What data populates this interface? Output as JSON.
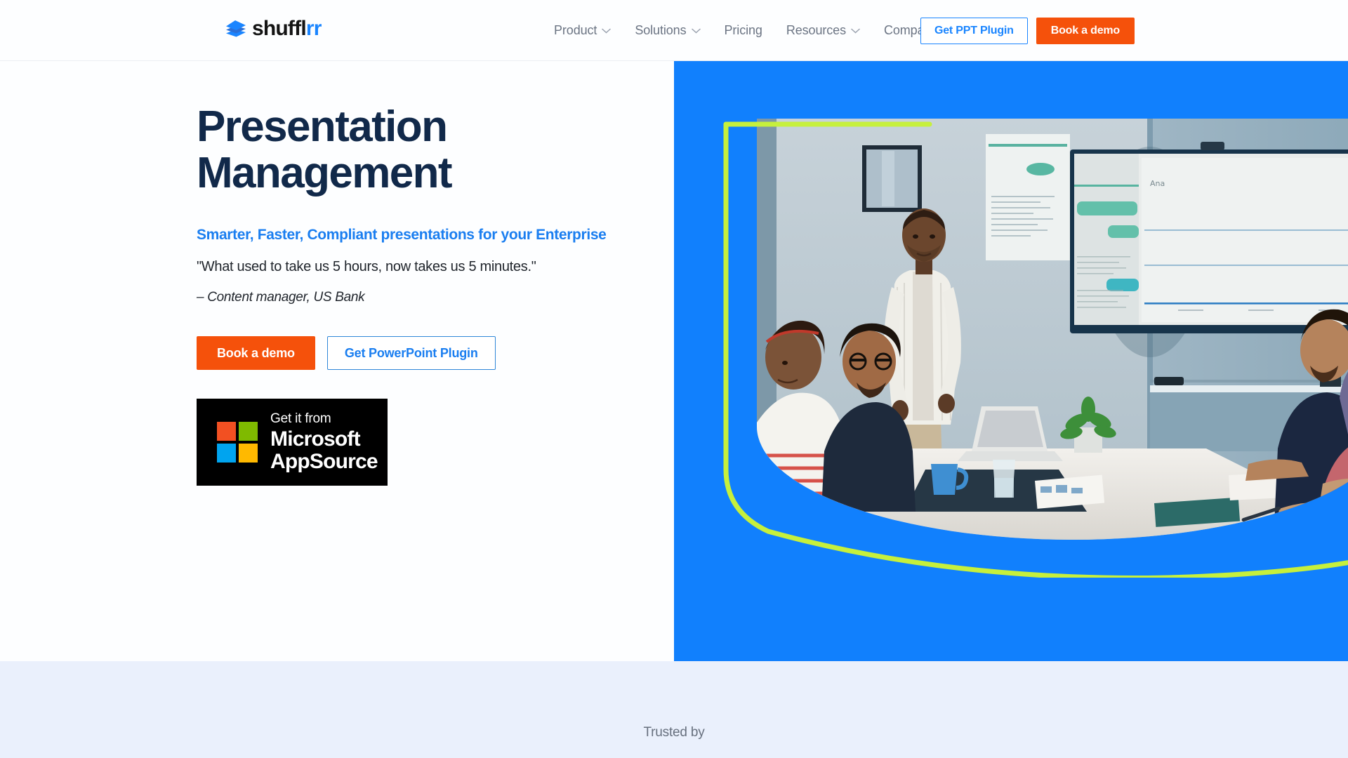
{
  "header": {
    "logo": {
      "text_dark": "shuffl",
      "text_accent": "rr",
      "icon": "stacked-papers-icon"
    },
    "nav": [
      {
        "label": "Product",
        "has_dropdown": true
      },
      {
        "label": "Solutions",
        "has_dropdown": true
      },
      {
        "label": "Pricing",
        "has_dropdown": false
      },
      {
        "label": "Resources",
        "has_dropdown": true
      },
      {
        "label": "Company",
        "has_dropdown": true
      }
    ],
    "cta_outline": "Get PPT Plugin",
    "cta_primary": "Book a demo"
  },
  "hero": {
    "title": "Presentation\nManagement",
    "subtitle": "Smarter, Faster, Compliant presentations for your Enterprise",
    "quote": "\"What used to take us 5 hours, now takes us 5 minutes.\"",
    "attribution": "– Content manager, US Bank",
    "cta_primary": "Book a demo",
    "cta_secondary": "Get PowerPoint Plugin",
    "appsource": {
      "line1": "Get it from",
      "line2": "Microsoft",
      "line3": "AppSource",
      "square_colors": [
        "#f25022",
        "#7fba00",
        "#00a4ef",
        "#ffb900"
      ]
    },
    "image_alt": "Conference room meeting with presenter and screen"
  },
  "trusted": {
    "label": "Trusted by"
  },
  "colors": {
    "brand_blue": "#1a85ff",
    "panel_blue": "#1180fd",
    "orange": "#f5510b",
    "navy": "#11294a",
    "lime": "#c6f03c",
    "trusted_bg": "#eaf0fc",
    "nav_text": "#6b7483"
  }
}
